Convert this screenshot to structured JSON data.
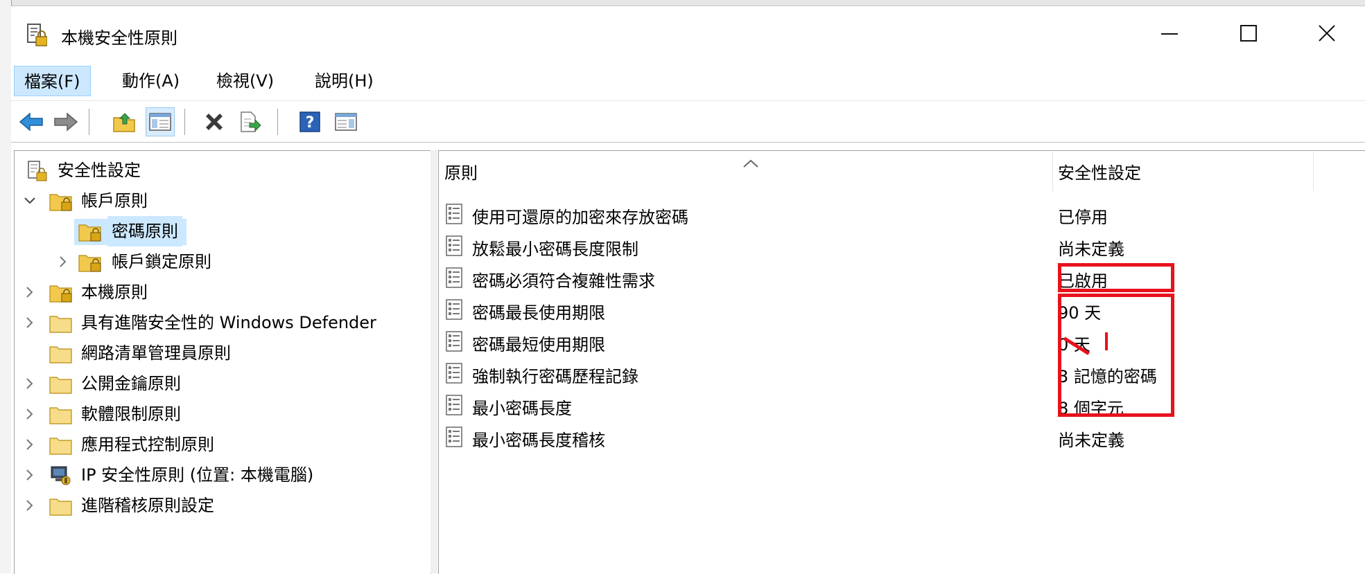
{
  "window": {
    "title": "本機安全性原則"
  },
  "menu": [
    {
      "label": "檔案(F)",
      "active": true
    },
    {
      "label": "動作(A)",
      "active": false
    },
    {
      "label": "檢視(V)",
      "active": false
    },
    {
      "label": "說明(H)",
      "active": false
    }
  ],
  "tree": {
    "root": "安全性設定",
    "items": [
      {
        "label": "帳戶原則",
        "expanded": true
      },
      {
        "label": "密碼原則",
        "selected": true
      },
      {
        "label": "帳戶鎖定原則"
      },
      {
        "label": "本機原則"
      },
      {
        "label": "具有進階安全性的 Windows Defender"
      },
      {
        "label": "網路清單管理員原則"
      },
      {
        "label": "公開金鑰原則"
      },
      {
        "label": "軟體限制原則"
      },
      {
        "label": "應用程式控制原則"
      },
      {
        "label": "IP 安全性原則 (位置: 本機電腦)"
      },
      {
        "label": "進階稽核原則設定"
      }
    ]
  },
  "list": {
    "headers": {
      "policy": "原則",
      "setting": "安全性設定"
    },
    "rows": [
      {
        "policy": "使用可還原的加密來存放密碼",
        "setting": "已停用"
      },
      {
        "policy": "放鬆最小密碼長度限制",
        "setting": "尚未定義"
      },
      {
        "policy": "密碼必須符合複雜性需求",
        "setting": "已啟用"
      },
      {
        "policy": "密碼最長使用期限",
        "setting": "90 天"
      },
      {
        "policy": "密碼最短使用期限",
        "setting": "0 天"
      },
      {
        "policy": "強制執行密碼歷程記錄",
        "setting": "3 記憶的密碼"
      },
      {
        "policy": "最小密碼長度",
        "setting": "8 個字元"
      },
      {
        "policy": "最小密碼長度稽核",
        "setting": "尚未定義"
      }
    ]
  },
  "icons": {
    "back": "back-arrow-icon",
    "forward": "forward-arrow-icon",
    "up": "up-folder-icon",
    "show_hide_tree": "show-hide-console-tree-icon",
    "delete": "delete-icon",
    "export": "export-list-icon",
    "help": "help-icon",
    "action_pane": "action-pane-icon"
  },
  "colors": {
    "selection": "#cce8ff",
    "annotation_red": "#e8121c",
    "folder_yellow": "#f2c94c"
  }
}
